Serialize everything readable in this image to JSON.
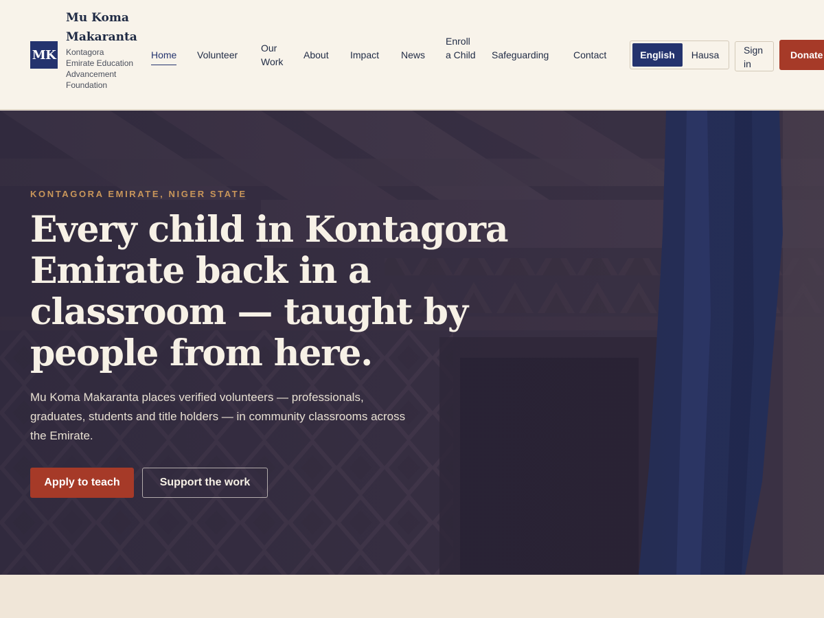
{
  "brand": {
    "logo_text": "MK",
    "name": "Mu Koma Makaranta",
    "subtitle": "Kontagora Emirate Education Advancement Foundation"
  },
  "nav": {
    "home": "Home",
    "volunteer": "Volunteer",
    "our_work": "Our Work",
    "about": "About",
    "impact": "Impact",
    "news": "News",
    "enroll": "Enroll a Child",
    "safeguarding": "Safeguarding",
    "contact": "Contact"
  },
  "language": {
    "selected": "English",
    "options": [
      "English",
      "Hausa"
    ],
    "english": "English",
    "hausa": "Hausa"
  },
  "actions": {
    "sign_in": "Sign in",
    "donate": "Donate"
  },
  "hero": {
    "eyebrow": "KONTAGORA EMIRATE, NIGER STATE",
    "headline": "Every child in Kontagora Emirate back in a classroom — taught by people from here.",
    "lede": "Mu Koma Makaranta places verified volunteers — professionals, graduates, students and title holders — in community classrooms across the Emirate.",
    "primary_cta": "Apply to teach",
    "secondary_cta": "Support the work"
  },
  "colors": {
    "navy": "#24336e",
    "terracotta": "#a63a28",
    "cream": "#f8f3ea",
    "gold": "#c9965a"
  }
}
